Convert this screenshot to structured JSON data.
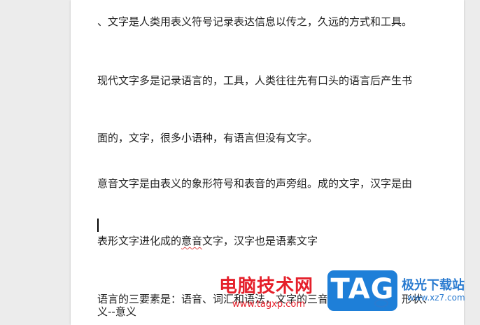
{
  "document": {
    "paragraphs": [
      "、文字是人类用表义符号记录表达信息以传之，久远的方式和工具。",
      "现代文字多是记录语言的，工具，人类往往先有口头的语言后产生书",
      "面的，文字，很多小语种，有语言但没有文字。",
      "意音文字是由表义的象形符号和表音的声旁组。成的文字，汉字是由",
      "语言的三要素是：语音、词汇和语法，文字的三音：语音、意义、形状、义--意义"
    ],
    "line5": {
      "before": "表形文字进化成的",
      "flagged": "意音",
      "after": "文字，汉字也是语素文字"
    }
  },
  "watermark": {
    "site_name": "电脑技术网",
    "site_url": "www.tagxp.com",
    "badge": "TAG",
    "site2_name": "极光下载站",
    "site2_url": "www.xz7.com"
  }
}
